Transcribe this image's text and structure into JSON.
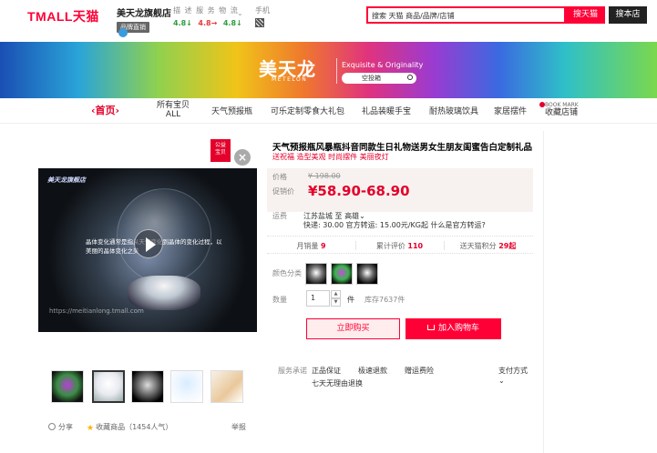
{
  "header": {
    "logo": "TMALL天猫",
    "shop_name": "美天龙旗舰店",
    "shop_badge": "品牌直销",
    "ratings_label": "描 述 服 务 物 流",
    "ratings": [
      "4.8↓",
      "4.8→",
      "4.8↓"
    ],
    "mobile_label": "手机",
    "search_placeholder": "搜索 天猫 商品/品牌/店铺",
    "search_tmall_btn": "搜天猫",
    "search_store_btn": "搜本店"
  },
  "banner": {
    "brand": "美天龙",
    "brand_sub": "METELON",
    "tagline": "Exquisite & Originality",
    "search_text": "空投箱"
  },
  "nav": {
    "home": "‹首页›",
    "all_line1": "所有宝贝",
    "all_line2": "ALL",
    "items": [
      "天气预报瓶",
      "可乐定制零食大礼包",
      "礼品装暖手宝",
      "耐热玻璃饮具",
      "家居摆件"
    ],
    "bookmark_small": "BOOK MARK",
    "bookmark": "收藏店铺"
  },
  "gallery": {
    "corner_badge_line1": "公益",
    "corner_badge_line2": "宝贝",
    "close": "×",
    "video_logo": "美天龙旗舰店",
    "video_caption": "晶体变化通常是指从天气变化到晶体的变化过程，以美丽的晶体变化之美",
    "video_url": "https://meitianlong.tmall.com",
    "share": "分享",
    "favorite": "收藏商品",
    "popularity": "（1454人气）",
    "report": "举报"
  },
  "product": {
    "title": "天气预报瓶风暴瓶抖音同款生日礼物送男女生朋友闺蜜告白定制礼品",
    "subtitle": "送祝福 造型美观 时尚摆件 美丽夜灯",
    "price_label": "价格",
    "original_price": "¥ 198.00",
    "promo_label": "促销价",
    "promo_price": "¥58.90-68.90",
    "shipping_label": "运费",
    "ship_from": "江苏盐城 至 高雄⌄",
    "ship_detail": "快递: 30.00 官方转运: 15.00元/KG起 什么是官方转运?",
    "monthly_sales_label": "月销量",
    "monthly_sales": "9",
    "reviews_label": "累计评价",
    "reviews": "110",
    "points_label": "送天猫积分",
    "points": "29起",
    "color_label": "颜色分类",
    "qty_label": "数量",
    "qty_value": "1",
    "qty_unit": "件",
    "stock": "库存7637件",
    "buy_now": "立即购买",
    "add_cart": "加入购物车",
    "service_label": "服务承诺",
    "services": [
      "正品保证",
      "极速退款",
      "赠运费险"
    ],
    "return_policy": "七天无理由退换",
    "pay_label": "支付方式",
    "pay_caret": "⌄"
  },
  "colors": {
    "accent": "#ff0036",
    "price_red": "#e4002b"
  }
}
